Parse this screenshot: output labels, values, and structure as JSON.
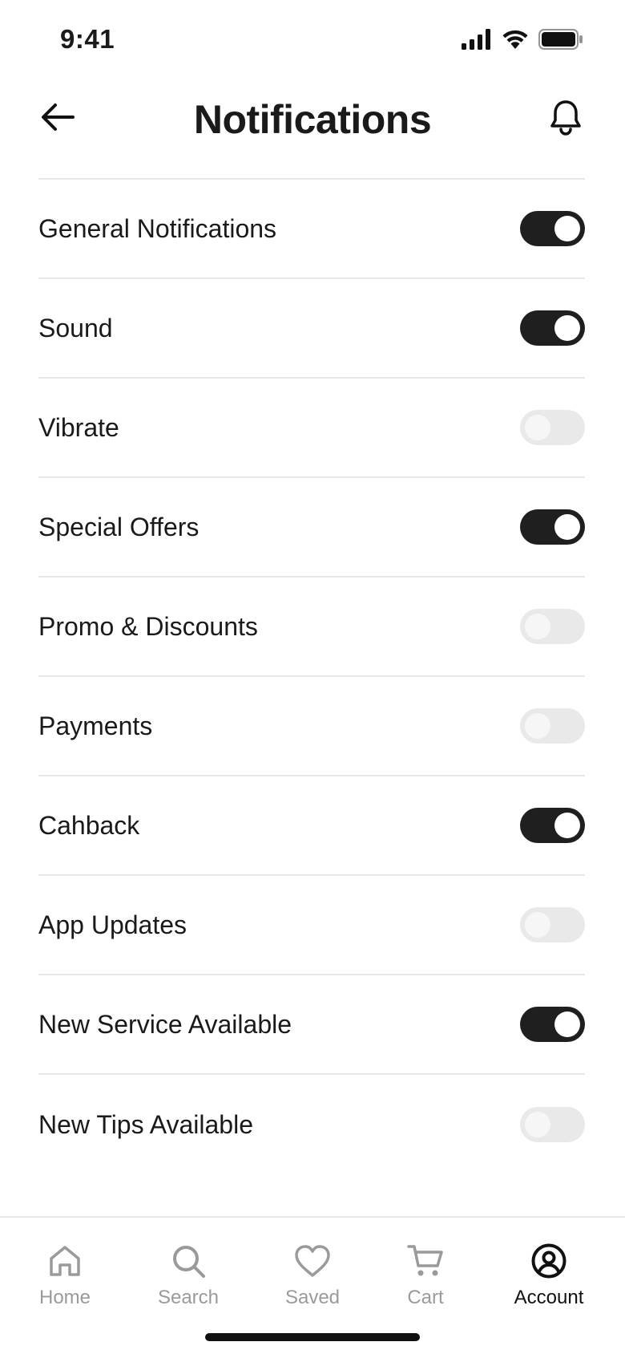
{
  "status_bar": {
    "time": "9:41",
    "icons": [
      "signal-icon",
      "wifi-icon",
      "battery-icon"
    ]
  },
  "header": {
    "title": "Notifications",
    "back_icon": "arrow-left-icon",
    "action_icon": "bell-icon"
  },
  "settings": [
    {
      "label": "General Notifications",
      "enabled": true
    },
    {
      "label": "Sound",
      "enabled": true
    },
    {
      "label": "Vibrate",
      "enabled": false
    },
    {
      "label": "Special Offers",
      "enabled": true
    },
    {
      "label": "Promo & Discounts",
      "enabled": false
    },
    {
      "label": "Payments",
      "enabled": false
    },
    {
      "label": "Cahback",
      "enabled": true
    },
    {
      "label": "App Updates",
      "enabled": false
    },
    {
      "label": "New Service Available",
      "enabled": true
    },
    {
      "label": "New Tips Available",
      "enabled": false
    }
  ],
  "nav": {
    "items": [
      {
        "label": "Home",
        "icon": "home-icon",
        "active": false
      },
      {
        "label": "Search",
        "icon": "search-icon",
        "active": false
      },
      {
        "label": "Saved",
        "icon": "heart-icon",
        "active": false
      },
      {
        "label": "Cart",
        "icon": "cart-icon",
        "active": false
      },
      {
        "label": "Account",
        "icon": "account-icon",
        "active": true
      }
    ]
  },
  "colors": {
    "toggle_on": "#1f1f1f",
    "toggle_off": "#e9e9e9",
    "nav_inactive": "#9a9a9a",
    "nav_active": "#111111"
  }
}
